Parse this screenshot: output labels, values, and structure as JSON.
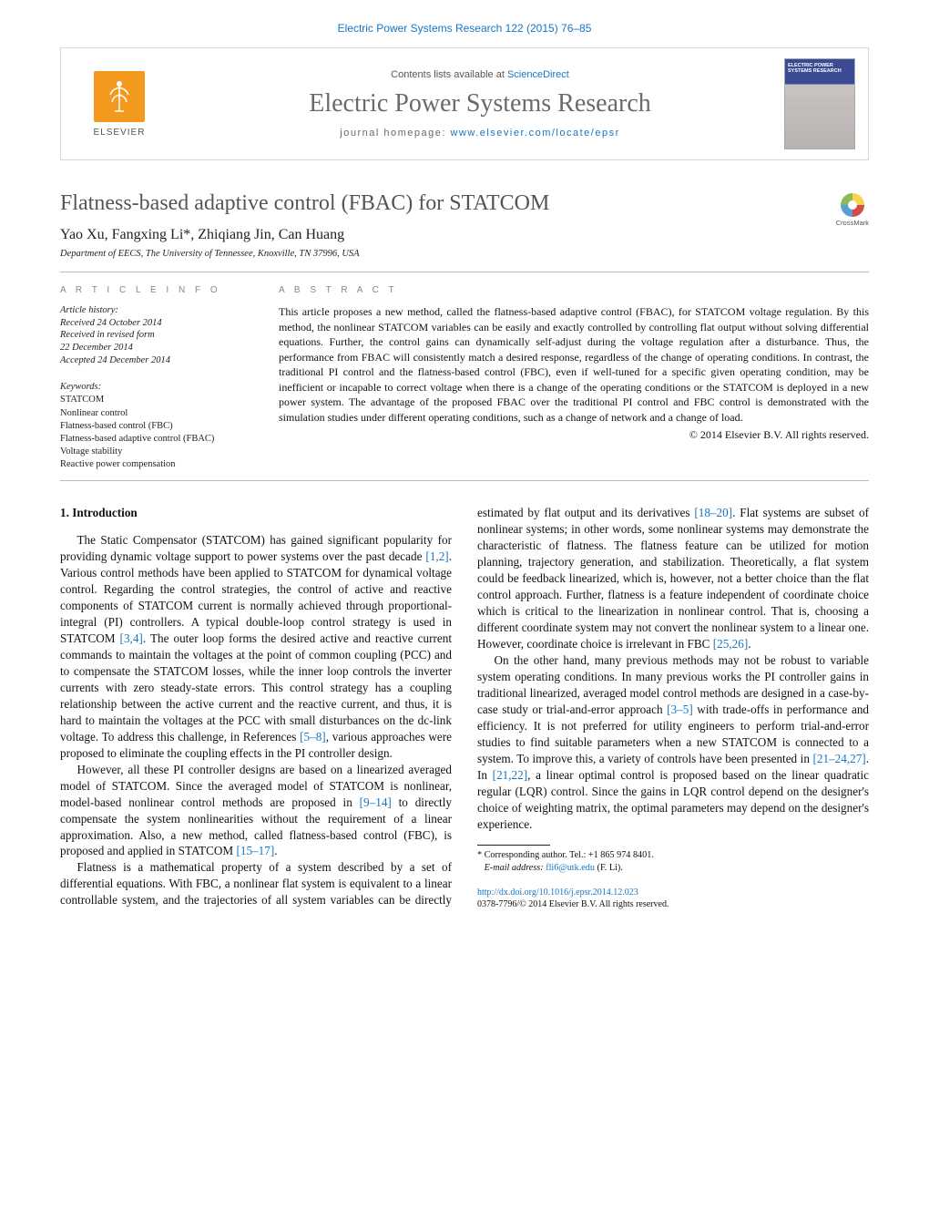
{
  "top_citation": "Electric Power Systems Research 122 (2015) 76–85",
  "header": {
    "contents_prefix": "Contents lists available at ",
    "contents_link": "ScienceDirect",
    "journal_name": "Electric Power Systems Research",
    "homepage_prefix": "journal homepage: ",
    "homepage_link": "www.elsevier.com/locate/epsr",
    "publisher_word": "ELSEVIER",
    "cover_title": "ELECTRIC POWER SYSTEMS RESEARCH"
  },
  "crossmark_label": "CrossMark",
  "article": {
    "title": "Flatness-based adaptive control (FBAC) for STATCOM",
    "authors_html": "Yao Xu, Fangxing Li",
    "authors_after_star": ", Zhiqiang Jin, Can Huang",
    "corresponding_marker": "*",
    "affiliation": "Department of EECS, The University of Tennessee, Knoxville, TN 37996, USA"
  },
  "info_heading": "A R T I C L E   I N F O",
  "abstract_heading": "A B S T R A C T",
  "history": {
    "label": "Article history:",
    "received": "Received 24 October 2014",
    "revised1": "Received in revised form",
    "revised2": "22 December 2014",
    "accepted": "Accepted 24 December 2014"
  },
  "keywords": {
    "label": "Keywords:",
    "items": [
      "STATCOM",
      "Nonlinear control",
      "Flatness-based control (FBC)",
      "Flatness-based adaptive control (FBAC)",
      "Voltage stability",
      "Reactive power compensation"
    ]
  },
  "abstract_text": "This article proposes a new method, called the flatness-based adaptive control (FBAC), for STATCOM voltage regulation. By this method, the nonlinear STATCOM variables can be easily and exactly controlled by controlling flat output without solving differential equations. Further, the control gains can dynamically self-adjust during the voltage regulation after a disturbance. Thus, the performance from FBAC will consistently match a desired response, regardless of the change of operating conditions. In contrast, the traditional PI control and the flatness-based control (FBC), even if well-tuned for a specific given operating condition, may be inefficient or incapable to correct voltage when there is a change of the operating conditions or the STATCOM is deployed in a new power system. The advantage of the proposed FBAC over the traditional PI control and FBC control is demonstrated with the simulation studies under different operating conditions, such as a change of network and a change of load.",
  "copyright_line": "© 2014 Elsevier B.V. All rights reserved.",
  "body": {
    "section_heading": "1.  Introduction",
    "p1a": "The Static Compensator (STATCOM) has gained significant popularity for providing dynamic voltage support to power systems over the past decade ",
    "r1": "[1,2]",
    "p1b": ". Various control methods have been applied to STATCOM for dynamical voltage control. Regarding the control strategies, the control of active and reactive components of STATCOM current is normally achieved through proportional-integral (PI) controllers. A typical double-loop control strategy is used in STATCOM ",
    "r2": "[3,4]",
    "p1c": ". The outer loop forms the desired active and reactive current commands to maintain the voltages at the point of common coupling (PCC) and to compensate the STATCOM losses, while the inner loop controls the inverter currents with zero steady-state errors. This control strategy has a coupling relationship between the active current and the reactive current, and thus, it is hard to maintain the voltages at the PCC with small disturbances on the dc-link voltage. To address this challenge, in References ",
    "r3": "[5–8]",
    "p1d": ", various approaches were proposed to eliminate the coupling effects in the PI controller design.",
    "p2a": "However, all these PI controller designs are based on a linearized averaged model of STATCOM. Since the averaged model of STATCOM is nonlinear, model-based nonlinear control methods are proposed in ",
    "r4": "[9–14]",
    "p2b": " to directly compensate the system nonlinearities without the requirement of a linear approximation. Also, a ",
    "p3a": "new method, called flatness-based control (FBC), is proposed and applied in STATCOM ",
    "r5": "[15–17]",
    "p3b": ".",
    "p4a": "Flatness is a mathematical property of a system described by a set of differential equations. With FBC, a nonlinear flat system is equivalent to a linear controllable system, and the trajectories of all system variables can be directly estimated by flat output and its derivatives ",
    "r6": "[18–20]",
    "p4b": ". Flat systems are subset of nonlinear systems; in other words, some nonlinear systems may demonstrate the characteristic of flatness. The flatness feature can be utilized for motion planning, trajectory generation, and stabilization. Theoretically, a flat system could be feedback linearized, which is, however, not a better choice than the flat control approach. Further, flatness is a feature independent of coordinate choice which is critical to the linearization in nonlinear control. That is, choosing a different coordinate system may not convert the nonlinear system to a linear one. However, coordinate choice is irrelevant in FBC ",
    "r7": "[25,26]",
    "p4c": ".",
    "p5a": "On the other hand, many previous methods may not be robust to variable system operating conditions. In many previous works the PI controller gains in traditional linearized, averaged model control methods are designed in a case-by-case study or trial-and-error approach ",
    "r8": "[3–5]",
    "p5b": " with trade-offs in performance and efficiency. It is not preferred for utility engineers to perform trial-and-error studies to find suitable parameters when a new STATCOM is connected to a system. To improve this, a variety of controls have been presented in ",
    "r9": "[21–24,27]",
    "p5c": ". In ",
    "r10": "[21,22]",
    "p5d": ", a linear optimal control is proposed based on the linear quadratic regular (LQR) control. Since the gains in LQR control depend on the designer's choice of weighting matrix, the optimal parameters may depend on the designer's experience."
  },
  "footnote": {
    "corr_label": "Corresponding author. Tel.: +1 865 974 8401.",
    "email_label": "E-mail address: ",
    "email": "fli6@utk.edu",
    "email_suffix": " (F. Li)."
  },
  "bottom": {
    "doi": "http://dx.doi.org/10.1016/j.epsr.2014.12.023",
    "issn_line": "0378-7796/© 2014 Elsevier B.V. All rights reserved."
  }
}
